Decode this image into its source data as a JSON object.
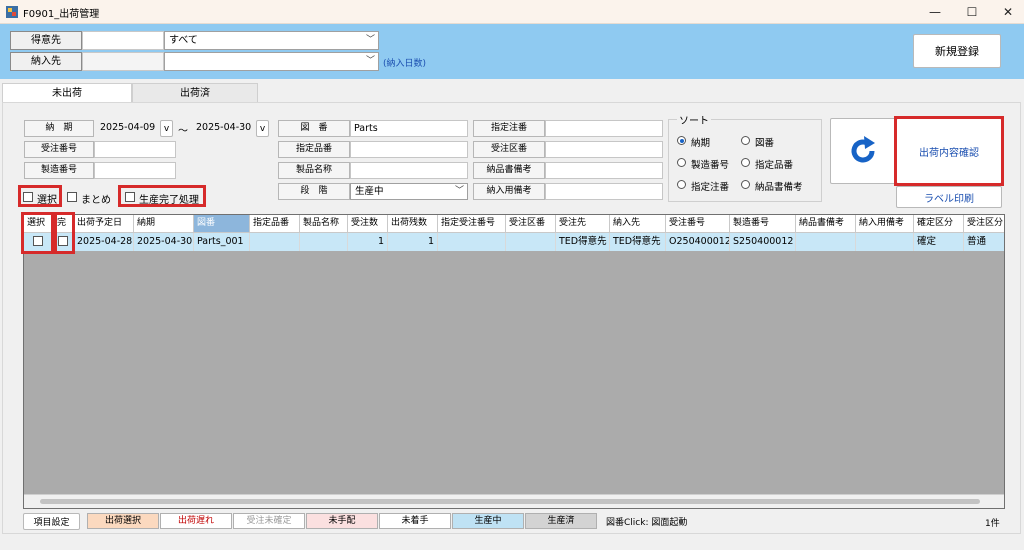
{
  "window": {
    "title": "F0901_出荷管理",
    "minimize": "—",
    "maximize": "☐",
    "close": "✕"
  },
  "header": {
    "customer_label": "得意先",
    "customer_value": "すべて",
    "delivery_label": "納入先",
    "delivery_days": "(納入日数)",
    "new_button": "新規登録"
  },
  "tabs": [
    {
      "label": "未出荷"
    },
    {
      "label": "出荷済"
    }
  ],
  "filters": {
    "due_label": "納　期",
    "date_from": "2025-04-09",
    "date_to": "2025-04-30",
    "tilde": "～",
    "v": "v",
    "order_no_label": "受注番号",
    "mfg_no_label": "製造番号",
    "drawing_label": "図　番",
    "drawing_value": "Parts",
    "spec_item_label": "指定品番",
    "product_name_label": "製品名称",
    "stage_label": "段　階",
    "stage_value": "生産中",
    "spec_order_label": "指定注番",
    "order_div_label": "受注区番",
    "delivery_note_label": "納品書備考",
    "delivery_remark_label": "納入用備考",
    "chk_select": "選択",
    "chk_group": "まとめ",
    "chk_prod_done": "生産完了処理"
  },
  "sort": {
    "title": "ソート",
    "options": [
      "納期",
      "図番",
      "製造番号",
      "指定品番",
      "指定注番",
      "納品書備考"
    ],
    "selected": 0
  },
  "actions": {
    "confirm": "出荷内容確認",
    "label_print": "ラベル印刷"
  },
  "grid": {
    "columns": [
      "選択",
      "完",
      "出荷予定日",
      "納期",
      "図番",
      "指定品番",
      "製品名称",
      "受注数",
      "出荷残数",
      "指定受注番号",
      "受注区番",
      "受注先",
      "納入先",
      "受注番号",
      "製造番号",
      "納品書備考",
      "納入用備考",
      "確定区分",
      "受注区分"
    ],
    "rows": [
      [
        "",
        "",
        "2025-04-28",
        "2025-04-30",
        "Parts_001",
        "",
        "",
        "1",
        "1",
        "",
        "",
        "TED得意先",
        "TED得意先",
        "O250400012",
        "S250400012",
        "",
        "",
        "確定",
        "普通"
      ]
    ]
  },
  "footer": {
    "settings": "項目設定",
    "legends": [
      {
        "label": "出荷選択",
        "bg": "#fbd9bf",
        "fg": "#000000"
      },
      {
        "label": "出荷遅れ",
        "bg": "#ffffff",
        "fg": "#c00000"
      },
      {
        "label": "受注未確定",
        "bg": "#ffffff",
        "fg": "#9a9a9a"
      },
      {
        "label": "未手配",
        "bg": "#fbe0e0",
        "fg": "#000000"
      },
      {
        "label": "未着手",
        "bg": "#ffffff",
        "fg": "#000000"
      },
      {
        "label": "生産中",
        "bg": "#bfe2f4",
        "fg": "#000000"
      },
      {
        "label": "生産済",
        "bg": "#d3d3d3",
        "fg": "#000000"
      }
    ],
    "hint": "図番Click: 図面起動",
    "count": "1件"
  },
  "colors": {
    "header_bg": "#8fcaf1",
    "accent_red": "#d62a2a",
    "link_blue": "#1763c6"
  }
}
